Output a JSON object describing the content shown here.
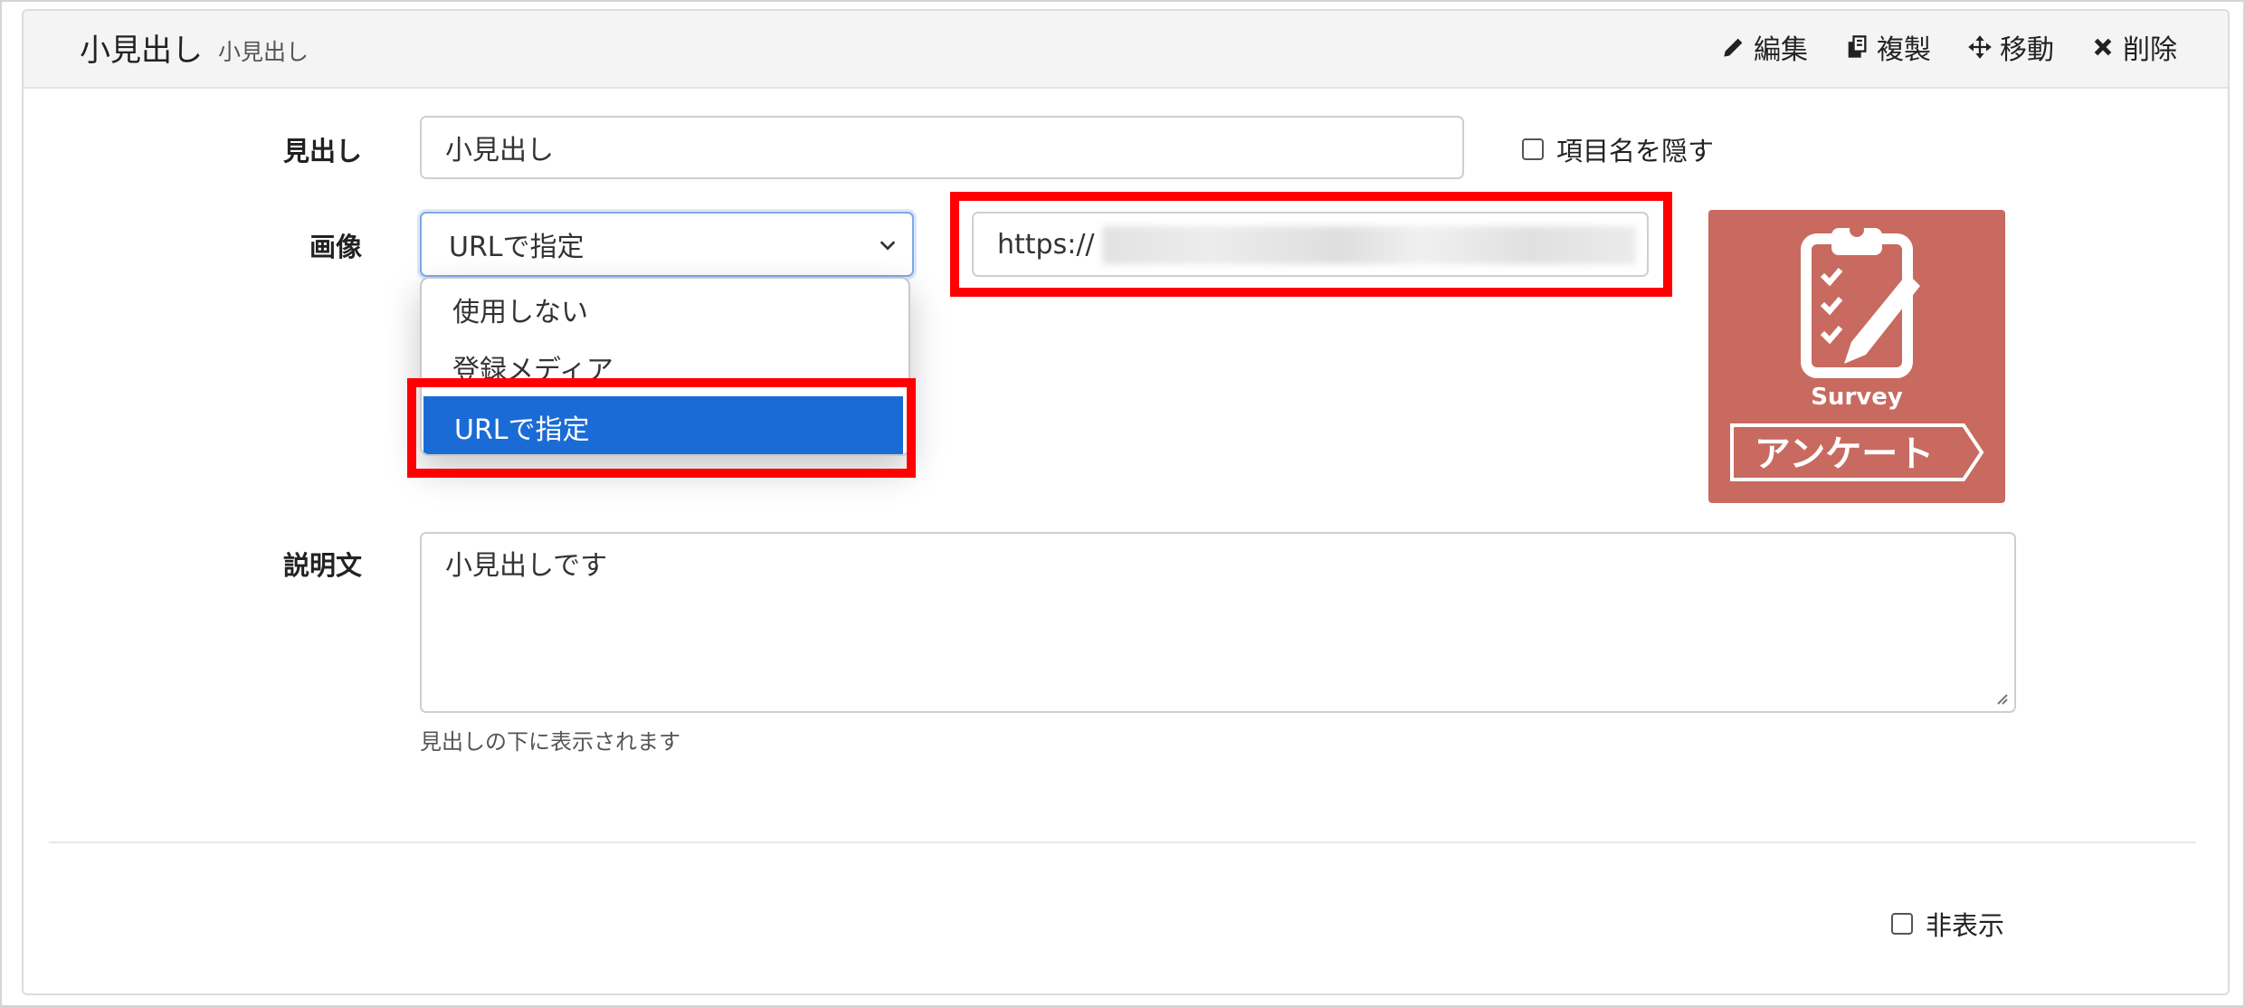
{
  "header": {
    "title": "小見出し",
    "subtitle": "小見出し",
    "actions": [
      {
        "label": "編集",
        "icon": "pencil-icon"
      },
      {
        "label": "複製",
        "icon": "copy-icon"
      },
      {
        "label": "移動",
        "icon": "move-icon"
      },
      {
        "label": "削除",
        "icon": "close-icon"
      }
    ]
  },
  "form": {
    "heading_label": "見出し",
    "heading_value": "小見出し",
    "hide_item_name_label": "項目名を隠す",
    "image_label": "画像",
    "image_select_value": "URLで指定",
    "image_options": [
      "使用しない",
      "登録メディア",
      "URLで指定"
    ],
    "url_value": "https://",
    "description_label": "説明文",
    "description_value": "小見出しです",
    "description_hint": "見出しの下に表示されます",
    "hidden_label": "非表示"
  },
  "preview_image": {
    "caption": "Survey",
    "banner_text": "アンケート",
    "background_color": "#c86a5f"
  },
  "highlight_color": "#ff0000",
  "selected_option_color": "#1b6bd6"
}
